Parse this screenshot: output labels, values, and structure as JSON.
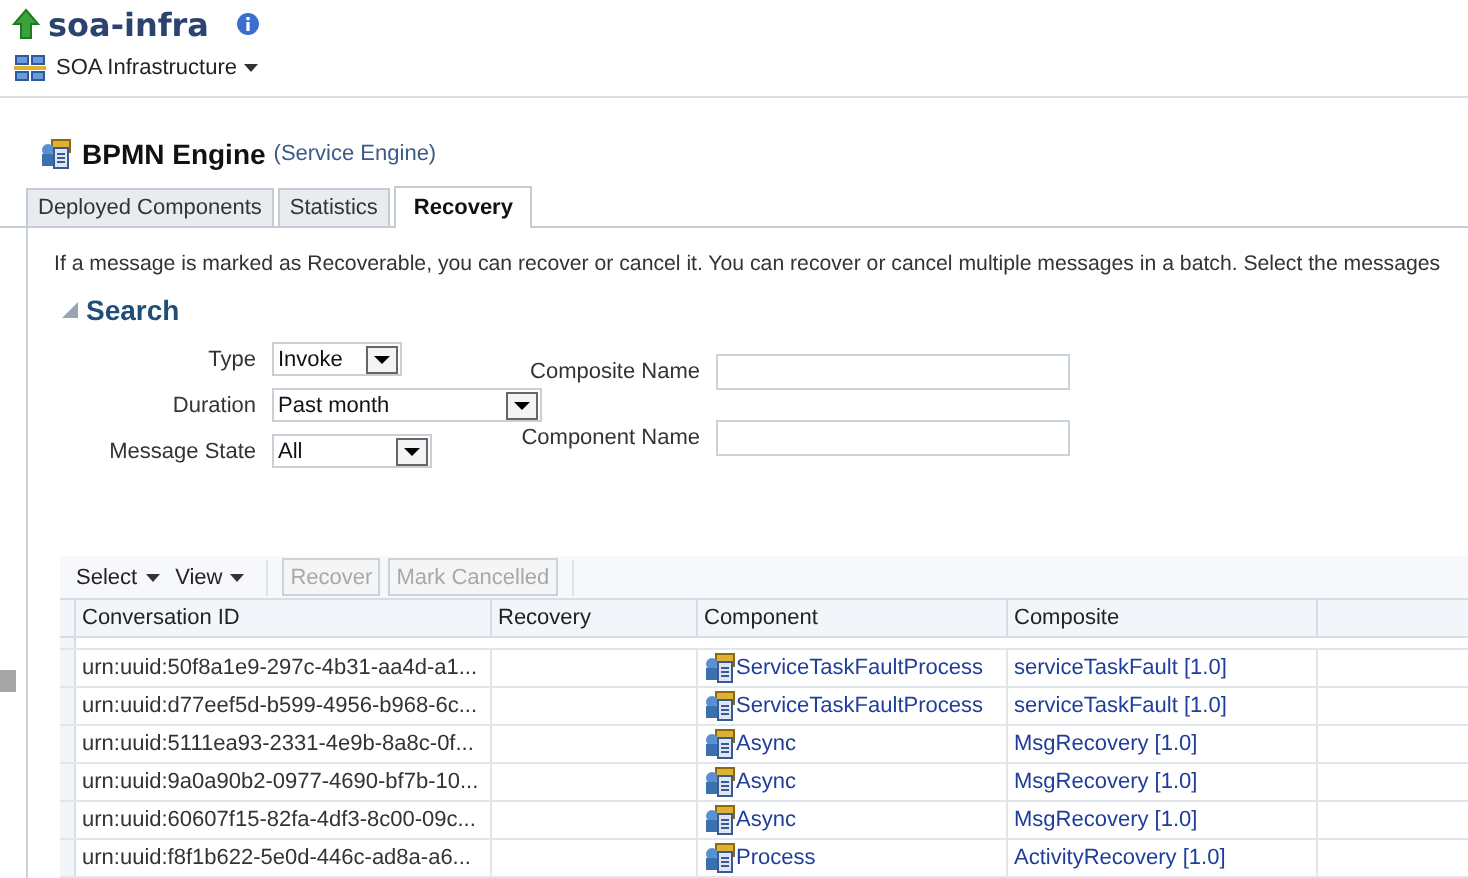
{
  "app": {
    "title": "soa-infra",
    "menu": "SOA Infrastructure"
  },
  "engine": {
    "name": "BPMN Engine",
    "type": "(Service Engine)"
  },
  "tabs": [
    {
      "label": "Deployed Components",
      "selected": false
    },
    {
      "label": "Statistics",
      "selected": false
    },
    {
      "label": "Recovery",
      "selected": true
    }
  ],
  "description": "If a message is marked as Recoverable, you can recover or cancel it. You can recover or cancel multiple messages in a batch. Select the messages",
  "search": {
    "title": "Search",
    "expanded": true,
    "left_fields": [
      {
        "kind": "select",
        "label": "Type",
        "value": "Invoke"
      },
      {
        "kind": "select",
        "label": "Duration",
        "value": "Past month"
      },
      {
        "kind": "select",
        "label": "Message State",
        "value": "All"
      }
    ],
    "right_fields": [
      {
        "kind": "text",
        "label": "Composite Name"
      },
      {
        "kind": "text",
        "label": "Component Name"
      }
    ]
  },
  "toolbar": {
    "menus": [
      "Select",
      "View"
    ],
    "buttons": [
      {
        "label": "Recover",
        "disabled": true
      },
      {
        "label": "Mark Cancelled",
        "disabled": true
      }
    ]
  },
  "table": {
    "columns": [
      "Conversation ID",
      "Recovery",
      "Component",
      "Composite"
    ],
    "rows": [
      {
        "conversation_id": "urn:uuid:50f8a1e9-297c-4b31-aa4d-a1...",
        "component": "ServiceTaskFaultProcess",
        "composite": "serviceTaskFault [1.0]"
      },
      {
        "conversation_id": "urn:uuid:d77eef5d-b599-4956-b968-6c...",
        "component": "ServiceTaskFaultProcess",
        "composite": "serviceTaskFault [1.0]"
      },
      {
        "conversation_id": "urn:uuid:5111ea93-2331-4e9b-8a8c-0f...",
        "component": "Async",
        "composite": "MsgRecovery [1.0]"
      },
      {
        "conversation_id": "urn:uuid:9a0a90b2-0977-4690-bf7b-10...",
        "component": "Async",
        "composite": "MsgRecovery [1.0]"
      },
      {
        "conversation_id": "urn:uuid:60607f15-82fa-4df3-8c00-09c...",
        "component": "Async",
        "composite": "MsgRecovery [1.0]"
      },
      {
        "conversation_id": "urn:uuid:f8f1b622-5e0d-446c-ad8a-a6...",
        "component": "Process",
        "composite": "ActivityRecovery [1.0]"
      }
    ]
  }
}
